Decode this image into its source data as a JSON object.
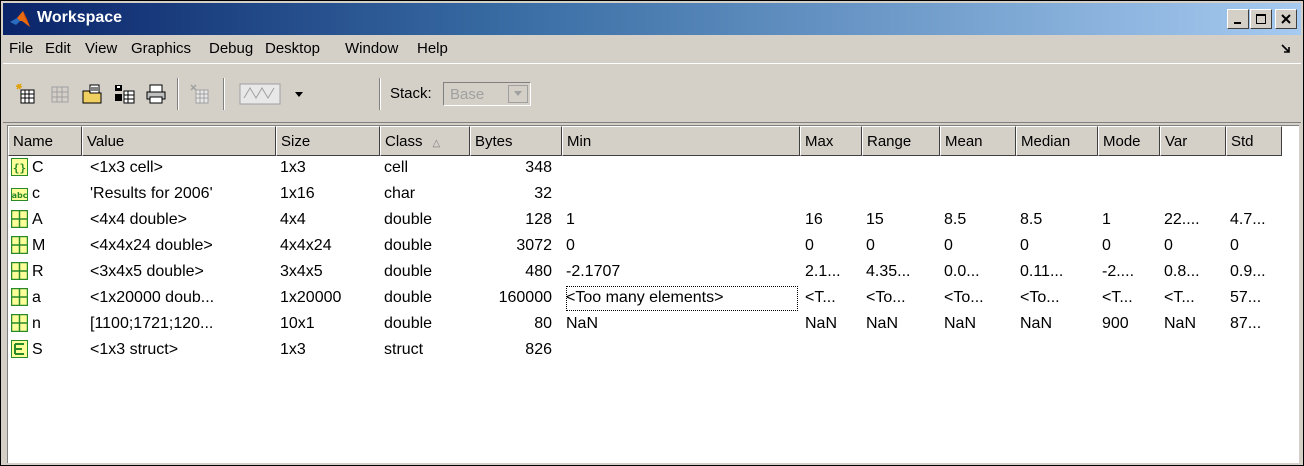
{
  "window": {
    "title": "Workspace"
  },
  "menu": [
    "File",
    "Edit",
    "View",
    "Graphics",
    "Debug",
    "Desktop",
    "Window",
    "Help"
  ],
  "toolbar": {
    "stack_label": "Stack:",
    "stack_value": "Base"
  },
  "columns": [
    "Name",
    "Value",
    "Size",
    "Class",
    "Bytes",
    "Min",
    "Max",
    "Range",
    "Mean",
    "Median",
    "Mode",
    "Var",
    "Std"
  ],
  "rows": [
    {
      "icon": "cell-icon",
      "name": "C",
      "value": "<1x3 cell>",
      "size": "1x3",
      "class": "cell",
      "bytes": "348",
      "min": "",
      "max": "",
      "range": "",
      "mean": "",
      "median": "",
      "mode": "",
      "var": "",
      "std": ""
    },
    {
      "icon": "char-icon",
      "name": "c",
      "value": "'Results for 2006'",
      "size": "1x16",
      "class": "char",
      "bytes": "32",
      "min": "",
      "max": "",
      "range": "",
      "mean": "",
      "median": "",
      "mode": "",
      "var": "",
      "std": ""
    },
    {
      "icon": "matrix-icon",
      "name": "A",
      "value": "<4x4 double>",
      "size": "4x4",
      "class": "double",
      "bytes": "128",
      "min": "1",
      "max": "16",
      "range": "15",
      "mean": "8.5",
      "median": "8.5",
      "mode": "1",
      "var": "22....",
      "std": "4.7..."
    },
    {
      "icon": "matrix-icon",
      "name": "M",
      "value": "<4x4x24 double>",
      "size": "4x4x24",
      "class": "double",
      "bytes": "3072",
      "min": "0",
      "max": "0",
      "range": "0",
      "mean": "0",
      "median": "0",
      "mode": "0",
      "var": "0",
      "std": "0"
    },
    {
      "icon": "matrix-icon",
      "name": "R",
      "value": "<3x4x5 double>",
      "size": "3x4x5",
      "class": "double",
      "bytes": "480",
      "min": "-2.1707",
      "max": "2.1...",
      "range": "4.35...",
      "mean": "0.0...",
      "median": "0.11...",
      "mode": "-2....",
      "var": "0.8...",
      "std": "0.9..."
    },
    {
      "icon": "matrix-icon",
      "name": "a",
      "value": "<1x20000 doub...",
      "size": "1x20000",
      "class": "double",
      "bytes": "160000",
      "min": "<Too many elements>",
      "max": "<T...",
      "range": "<To...",
      "mean": "<To...",
      "median": "<To...",
      "mode": "<T...",
      "var": "<T...",
      "std": "57..."
    },
    {
      "icon": "matrix-icon",
      "name": "n",
      "value": "[1100;1721;120...",
      "size": "10x1",
      "class": "double",
      "bytes": "80",
      "min": "NaN",
      "max": "NaN",
      "range": "NaN",
      "mean": "NaN",
      "median": "NaN",
      "mode": "900",
      "var": "NaN",
      "std": "87..."
    },
    {
      "icon": "struct-icon",
      "name": "S",
      "value": "<1x3 struct>",
      "size": "1x3",
      "class": "struct",
      "bytes": "826",
      "min": "",
      "max": "",
      "range": "",
      "mean": "",
      "median": "",
      "mode": "",
      "var": "",
      "std": ""
    }
  ]
}
